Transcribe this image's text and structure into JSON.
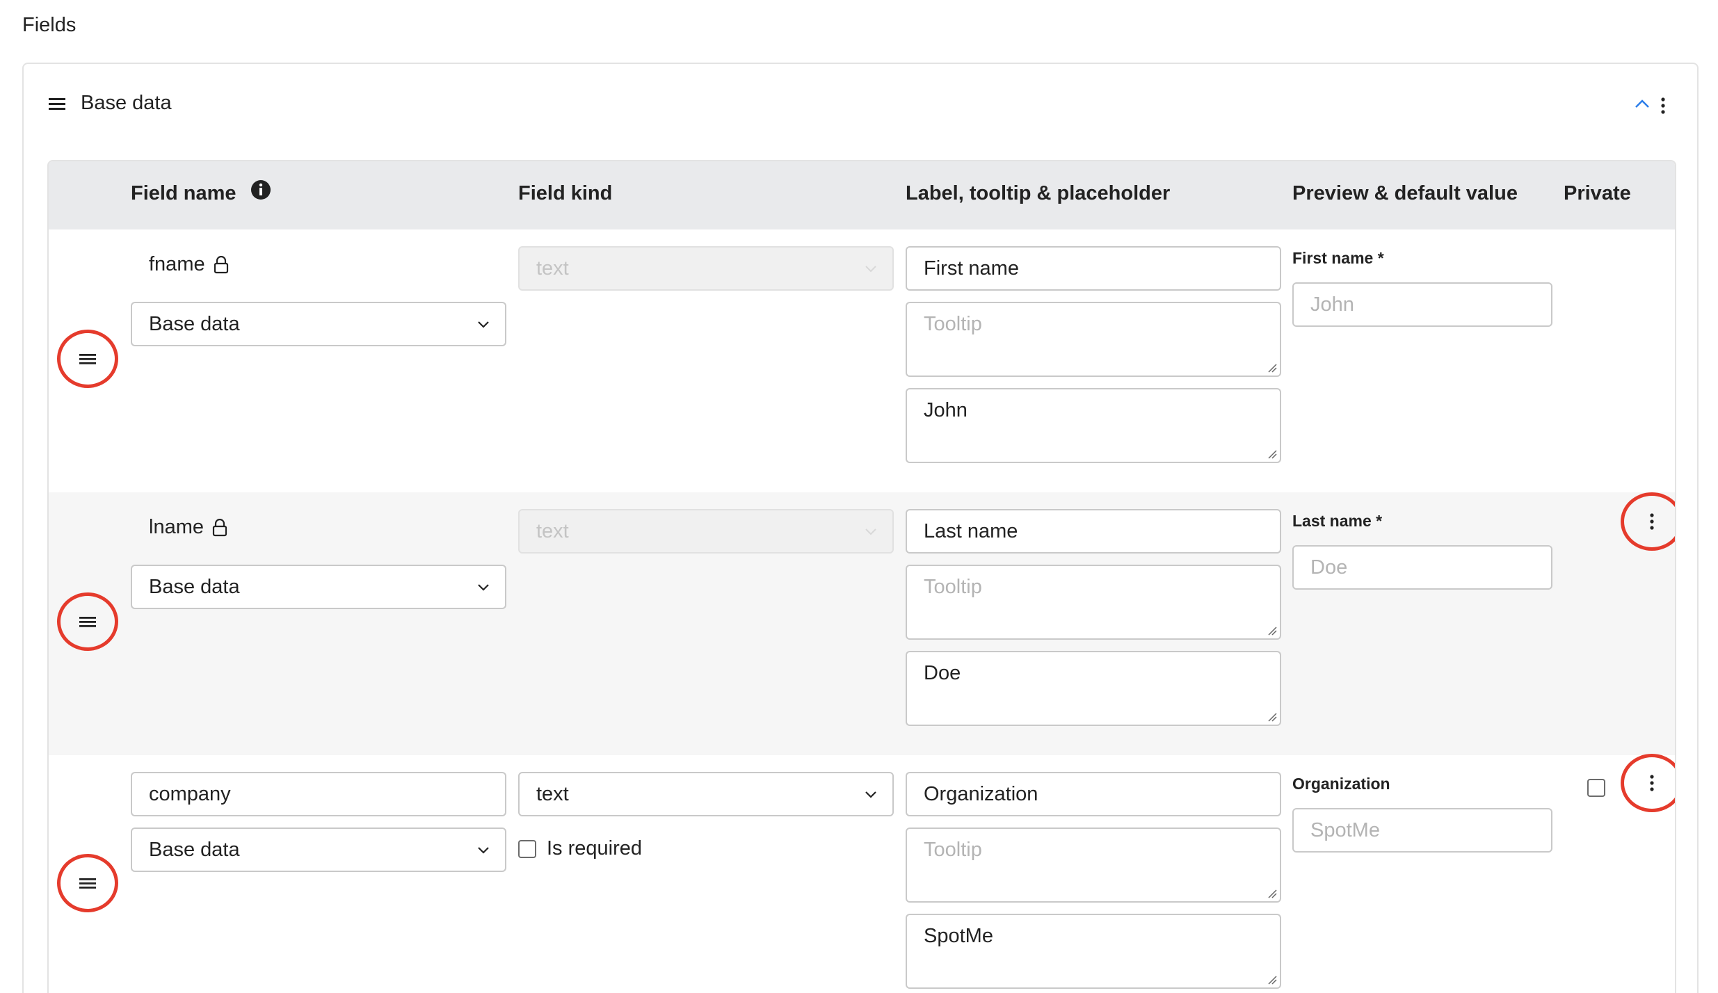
{
  "page": {
    "title": "Fields"
  },
  "section": {
    "title": "Base data"
  },
  "columns": {
    "field_name": "Field name",
    "field_kind": "Field kind",
    "label": "Label, tooltip & placeholder",
    "preview": "Preview & default value",
    "private": "Private"
  },
  "rows": [
    {
      "field_name": "fname",
      "locked": true,
      "group": "Base data",
      "kind": "text",
      "kind_disabled": true,
      "label": "First name",
      "tooltip_placeholder": "Tooltip",
      "placeholder_value": "John",
      "preview_label": "First name *",
      "preview_placeholder": "John"
    },
    {
      "field_name": "lname",
      "locked": true,
      "group": "Base data",
      "kind": "text",
      "kind_disabled": true,
      "label": "Last name",
      "tooltip_placeholder": "Tooltip",
      "placeholder_value": "Doe",
      "preview_label": "Last name *",
      "preview_placeholder": "Doe"
    },
    {
      "field_name": "company",
      "locked": false,
      "group": "Base data",
      "kind": "text",
      "kind_disabled": false,
      "is_required_label": "Is required",
      "is_required_checked": false,
      "private_checked": false,
      "label": "Organization",
      "tooltip_placeholder": "Tooltip",
      "placeholder_value": "SpotMe",
      "preview_label": "Organization",
      "preview_placeholder": "SpotMe"
    }
  ],
  "icons": {
    "drag": "hamburger-icon",
    "menu": "kebab-icon",
    "lock": "lock-icon",
    "info": "info-icon",
    "collapse": "chevron-up-icon"
  },
  "colors": {
    "highlight": "#e53b2c",
    "accent": "#2b7de9"
  }
}
